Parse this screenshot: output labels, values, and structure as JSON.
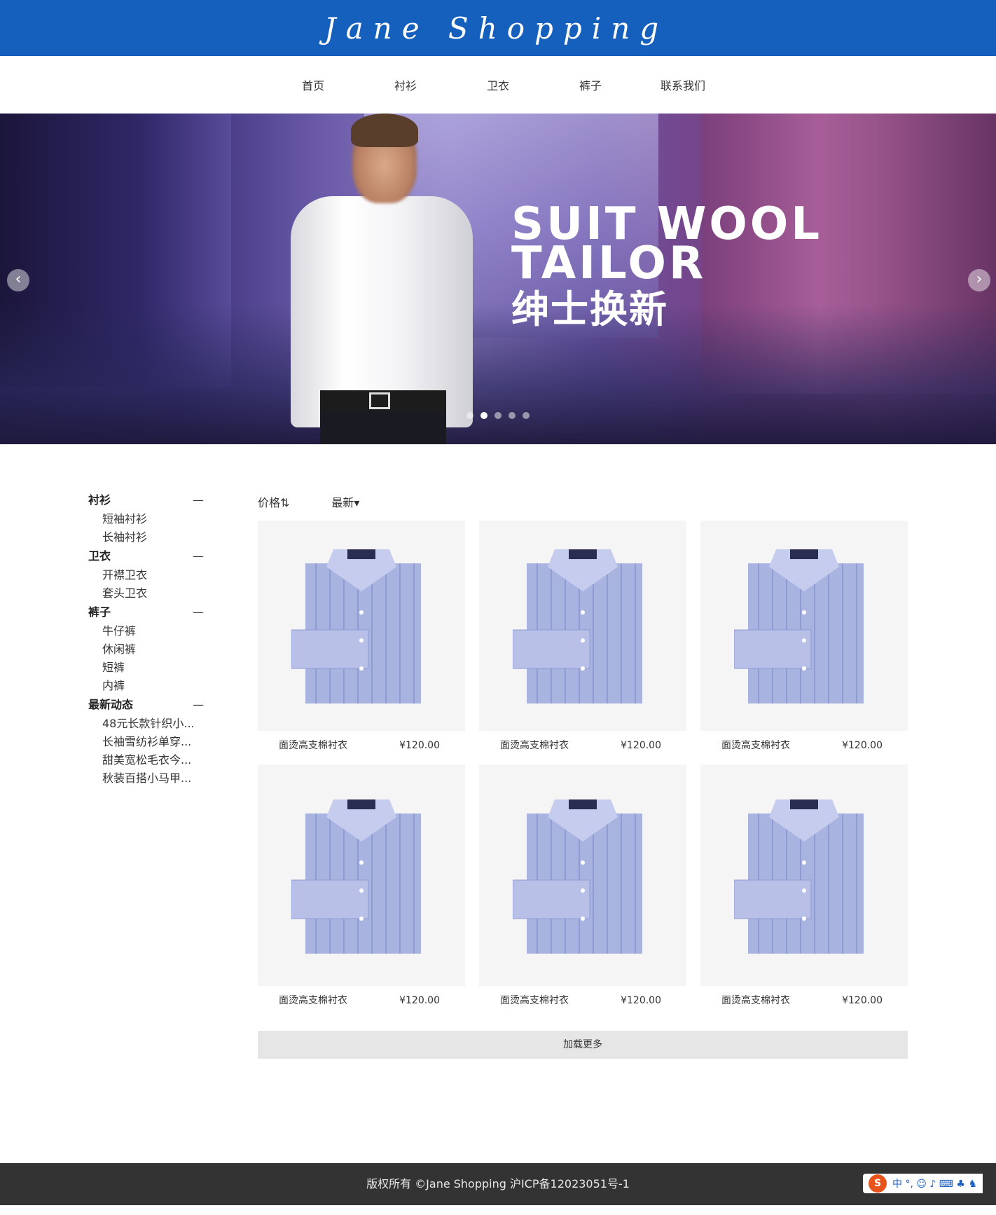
{
  "header": {
    "logo": "Jane Shopping"
  },
  "nav": {
    "items": [
      {
        "label": "首页"
      },
      {
        "label": "衬衫"
      },
      {
        "label": "卫衣"
      },
      {
        "label": "裤子"
      },
      {
        "label": "联系我们"
      }
    ]
  },
  "banner": {
    "line1": "SUIT  WOOL",
    "line2": "TAILOR",
    "line3": "绅士换新",
    "prev_icon": "chevron-left-icon",
    "next_icon": "chevron-right-icon",
    "slides": 5,
    "active_slide": 2
  },
  "sidebar": {
    "categories": [
      {
        "title": "衬衫",
        "toggle": "—",
        "items": [
          "短袖衬衫",
          "长袖衬衫"
        ]
      },
      {
        "title": "卫衣",
        "toggle": "—",
        "items": [
          "开襟卫衣",
          "套头卫衣"
        ]
      },
      {
        "title": "裤子",
        "toggle": "—",
        "items": [
          "牛仔裤",
          "休闲裤",
          "短裤",
          "内裤"
        ]
      },
      {
        "title": "最新动态",
        "toggle": "—",
        "items": [
          "48元长款针织小...",
          "长袖雪纺衫单穿...",
          "甜美宽松毛衣今...",
          "秋装百搭小马甲..."
        ]
      }
    ]
  },
  "sort": {
    "price": "价格⇅",
    "latest": "最新▾"
  },
  "products": [
    {
      "name": "面烫高支棉衬衣",
      "price": "¥120.00"
    },
    {
      "name": "面烫高支棉衬衣",
      "price": "¥120.00"
    },
    {
      "name": "面烫高支棉衬衣",
      "price": "¥120.00"
    },
    {
      "name": "面烫高支棉衬衣",
      "price": "¥120.00"
    },
    {
      "name": "面烫高支棉衬衣",
      "price": "¥120.00"
    },
    {
      "name": "面烫高支棉衬衣",
      "price": "¥120.00"
    }
  ],
  "load_more": "加载更多",
  "footer": {
    "text": "版权所有 ©Jane Shopping 沪ICP备12023051号-1"
  },
  "ime": {
    "logo": "S",
    "label": "中 °, ☺ ♪ ⌨ ♣ ♞"
  }
}
